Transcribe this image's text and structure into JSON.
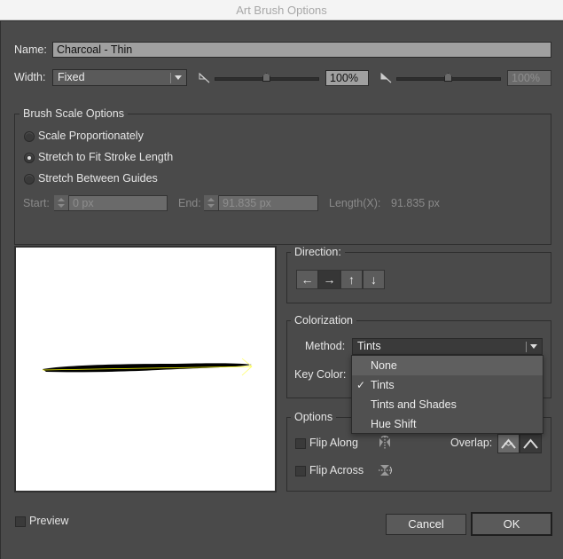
{
  "window": {
    "title": "Art Brush Options"
  },
  "name_field": {
    "label": "Name:",
    "value": "Charcoal - Thin"
  },
  "width": {
    "label": "Width:",
    "select_value": "Fixed",
    "min_value": "100%",
    "max_value": "100%",
    "min_slider_position": 0.5,
    "max_slider_position": 0.5
  },
  "brush_scale": {
    "title": "Brush Scale Options",
    "options": [
      {
        "label": "Scale Proportionately",
        "selected": false
      },
      {
        "label": "Stretch to Fit Stroke Length",
        "selected": true
      },
      {
        "label": "Stretch Between Guides",
        "selected": false
      }
    ],
    "start_label": "Start:",
    "start_value": "0 px",
    "end_label": "End:",
    "end_value": "91.835 px",
    "length_label": "Length(X):",
    "length_value": "91.835 px"
  },
  "direction": {
    "title": "Direction:",
    "buttons": [
      {
        "glyph": "←",
        "name": "left",
        "active": false
      },
      {
        "glyph": "→",
        "name": "right",
        "active": true
      },
      {
        "glyph": "↑",
        "name": "up",
        "active": false
      },
      {
        "glyph": "↓",
        "name": "down",
        "active": false
      }
    ]
  },
  "colorization": {
    "title": "Colorization",
    "method_label": "Method:",
    "method_value": "Tints",
    "key_color_label": "Key Color:",
    "menu_items": [
      {
        "label": "None",
        "checked": false,
        "hover": true
      },
      {
        "label": "Tints",
        "checked": true,
        "hover": false
      },
      {
        "label": "Tints and Shades",
        "checked": false,
        "hover": false
      },
      {
        "label": "Hue Shift",
        "checked": false,
        "hover": false
      }
    ],
    "check_glyph": "✓"
  },
  "options": {
    "title": "Options",
    "flip_along_label": "Flip Along",
    "flip_across_label": "Flip Across",
    "overlap_label": "Overlap:"
  },
  "footer": {
    "preview_label": "Preview",
    "cancel_label": "Cancel",
    "ok_label": "OK"
  },
  "colors": {
    "dialog_bg": "#4a4a4a",
    "preview_bg": "#ffffff",
    "stroke": "#000000",
    "guide": "#ffff00"
  }
}
